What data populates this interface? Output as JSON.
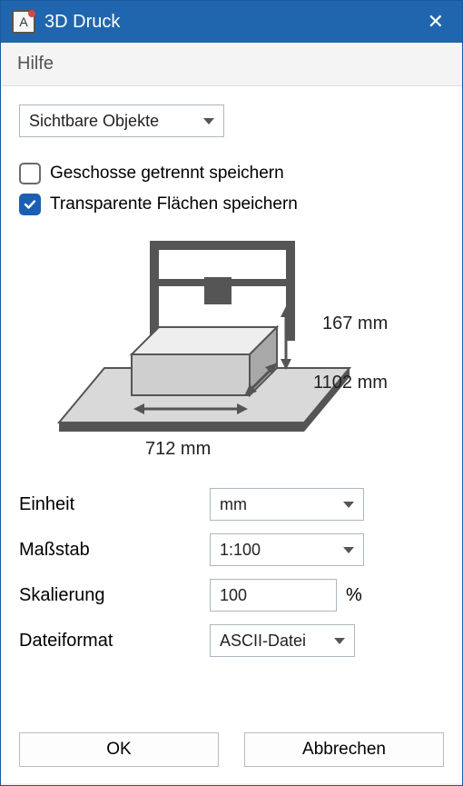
{
  "title": "3D Druck",
  "menu": {
    "help": "Hilfe"
  },
  "objects_dropdown": {
    "selected": "Sichtbare Objekte"
  },
  "checkboxes": {
    "separate_storeys": {
      "label": "Geschosse getrennt speichern",
      "checked": false
    },
    "transparent_faces": {
      "label": "Transparente Flächen speichern",
      "checked": true
    }
  },
  "dimensions": {
    "height": "167 mm",
    "depth": "1102 mm",
    "width": "712 mm"
  },
  "fields": {
    "unit": {
      "label": "Einheit",
      "value": "mm"
    },
    "scale": {
      "label": "Maßstab",
      "value": "1:100"
    },
    "scaling": {
      "label": "Skalierung",
      "value": "100",
      "suffix": "%"
    },
    "format": {
      "label": "Dateiformat",
      "value": "ASCII-Datei"
    }
  },
  "buttons": {
    "ok": "OK",
    "cancel": "Abbrechen"
  }
}
